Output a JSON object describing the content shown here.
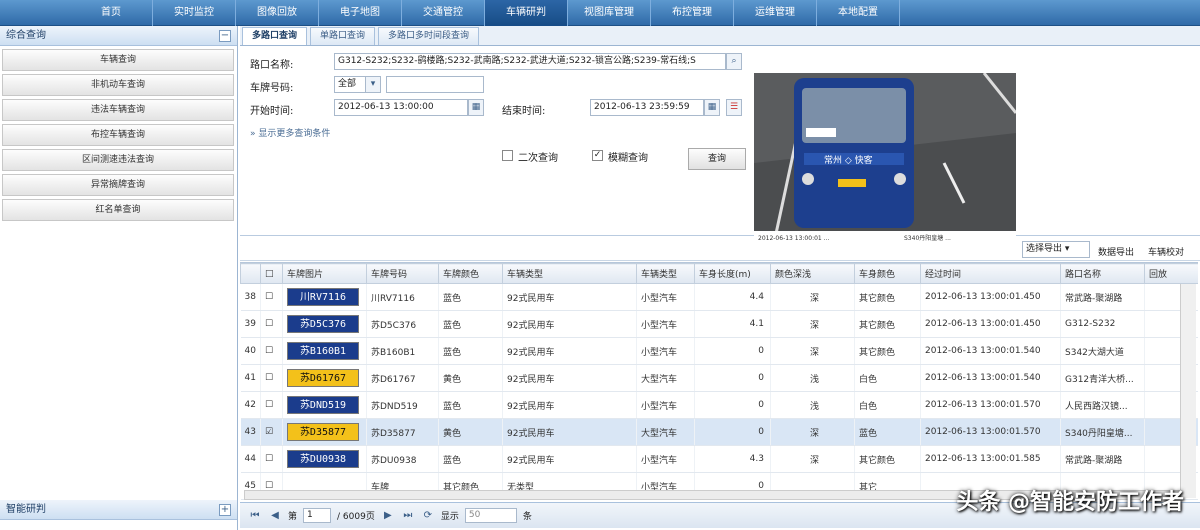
{
  "nav": {
    "items": [
      "首页",
      "实时监控",
      "图像回放",
      "电子地图",
      "交通管控",
      "车辆研判",
      "视图库管理",
      "布控管理",
      "运维管理",
      "本地配置"
    ],
    "active_index": 5
  },
  "sidebar": {
    "title": "综合查询",
    "items": [
      "车辆查询",
      "非机动车查询",
      "违法车辆查询",
      "布控车辆查询",
      "区间测速违法查询",
      "异常摘牌查询",
      "红名单查询"
    ],
    "bottom_title": "智能研判",
    "toggle_minus": "−",
    "toggle_plus": "+"
  },
  "tabs": [
    "多路口查询",
    "单路口查询",
    "多路口多时间段查询"
  ],
  "form": {
    "crossing_label": "路口名称:",
    "crossing_value": "G312-S232;S232-鹞楼路;S232-武南路;S232-武进大道;S232-锁宫公路;S239-常石线;S",
    "plate_label": "车牌号码:",
    "plate_select": "全部",
    "start_label": "开始时间:",
    "start_value": "2012-06-13 13:00:00",
    "end_label": "结束时间:",
    "end_value": "2012-06-13 23:59:59",
    "more": "显示更多查询条件",
    "second_query": "二次查询",
    "fuzzy_query": "模糊查询",
    "query_button": "查询"
  },
  "photo": {
    "route_sign": "常州 ◇ 快客",
    "front_plate": "苏D35877",
    "caption_left": "2012-06-13 13:00:01 ...",
    "caption_right": "S340丹阳皇塘 ..."
  },
  "toolbar": {
    "export_select": "选择导出",
    "export": "数据导出",
    "verify": "车辆校对"
  },
  "columns": [
    "",
    "车牌图片",
    "车牌号码",
    "车牌颜色",
    "车辆类型",
    "车辆类型",
    "车身长度(m)",
    "颜色深浅",
    "车身颜色",
    "经过时间",
    "路口名称",
    "回放"
  ],
  "rows": [
    {
      "idx": "38",
      "plate_img": "川RV7116",
      "plate": "川RV7116",
      "pcolor": "蓝色",
      "vtype": "92式民用车",
      "ctype": "小型汽车",
      "len": "4.4",
      "shade": "深",
      "body": "其它颜色",
      "time": "2012-06-13 13:00:01.450",
      "place": "常武路-聚湖路",
      "checked": false
    },
    {
      "idx": "39",
      "plate_img": "苏D5C376",
      "plate": "苏D5C376",
      "pcolor": "蓝色",
      "vtype": "92式民用车",
      "ctype": "小型汽车",
      "len": "4.1",
      "shade": "深",
      "body": "其它颜色",
      "time": "2012-06-13 13:00:01.450",
      "place": "G312-S232",
      "checked": false
    },
    {
      "idx": "40",
      "plate_img": "苏B160B1",
      "plate": "苏B160B1",
      "pcolor": "蓝色",
      "vtype": "92式民用车",
      "ctype": "小型汽车",
      "len": "0",
      "shade": "深",
      "body": "其它颜色",
      "time": "2012-06-13 13:00:01.540",
      "place": "S342大湖大道",
      "checked": false
    },
    {
      "idx": "41",
      "plate_img": "苏D61767",
      "plate": "苏D61767",
      "pcolor": "黄色",
      "vtype": "92式民用车",
      "ctype": "大型汽车",
      "len": "0",
      "shade": "浅",
      "body": "白色",
      "time": "2012-06-13 13:00:01.540",
      "place": "G312青洋大桥...",
      "checked": false
    },
    {
      "idx": "42",
      "plate_img": "苏DND519",
      "plate": "苏DND519",
      "pcolor": "蓝色",
      "vtype": "92式民用车",
      "ctype": "小型汽车",
      "len": "0",
      "shade": "浅",
      "body": "白色",
      "time": "2012-06-13 13:00:01.570",
      "place": "人民西路汉镜...",
      "checked": false
    },
    {
      "idx": "43",
      "plate_img": "苏D35877",
      "plate": "苏D35877",
      "pcolor": "黄色",
      "vtype": "92式民用车",
      "ctype": "大型汽车",
      "len": "0",
      "shade": "深",
      "body": "蓝色",
      "time": "2012-06-13 13:00:01.570",
      "place": "S340丹阳皇塘...",
      "checked": true
    },
    {
      "idx": "44",
      "plate_img": "苏DU0938",
      "plate": "苏DU0938",
      "pcolor": "蓝色",
      "vtype": "92式民用车",
      "ctype": "小型汽车",
      "len": "4.3",
      "shade": "深",
      "body": "其它颜色",
      "time": "2012-06-13 13:00:01.585",
      "place": "常武路-聚湖路",
      "checked": false
    },
    {
      "idx": "45",
      "plate_img": "",
      "plate": "车牌",
      "pcolor": "其它颜色",
      "vtype": "无类型",
      "ctype": "小型汽车",
      "len": "0",
      "shade": "",
      "body": "其它",
      "time": "",
      "place": "",
      "checked": false
    }
  ],
  "pager": {
    "page_label": "第",
    "page": "1",
    "total": "/ 6009页",
    "show": "显示",
    "page_size": "50",
    "unit": "条"
  },
  "watermark": "头条 @智能安防工作者",
  "colors": {
    "nav": "#2f6aa8",
    "blue_plate": "#1b3c8c",
    "yellow_plate": "#f3c11a"
  }
}
